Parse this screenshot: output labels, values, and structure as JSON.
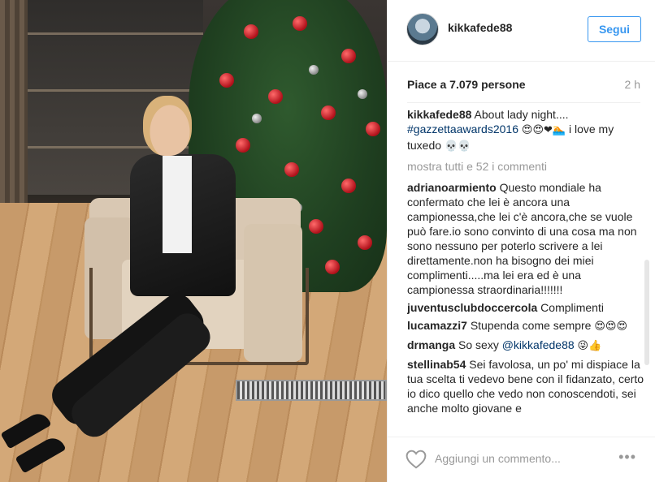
{
  "post": {
    "username": "kikkafede88",
    "follow_label": "Segui",
    "likes": "Piace a 7.079 persone",
    "time": "2 h"
  },
  "caption": {
    "user": "kikkafede88",
    "text_a": "About lady night....",
    "hashtag": "#gazzettaawards2016",
    "emoji_a": "😍😍❤🏊",
    "text_b": " i love my tuxedo ",
    "emoji_b": "💀💀"
  },
  "show_all": "mostra tutti e 52 i commenti",
  "comments": [
    {
      "user": "adrianoarmiento",
      "text": "Questo mondiale ha confermato che lei è ancora una campionessa,che lei c'è ancora,che se vuole può fare.io sono convinto di una cosa ma non sono nessuno per poterlo scrivere a lei direttamente.non ha bisogno dei miei complimenti.....ma lei era ed è una campionessa straordinaria!!!!!!!",
      "mention": "",
      "emoji": ""
    },
    {
      "user": "juventusclubdoccercola",
      "text": "Complimenti",
      "mention": "",
      "emoji": ""
    },
    {
      "user": "lucamazzi7",
      "text": "Stupenda come sempre",
      "mention": "",
      "emoji": "😍😍😍"
    },
    {
      "user": "drmanga",
      "text": "So sexy",
      "mention": "@kikkafede88",
      "emoji": "😜👍"
    },
    {
      "user": "stellinab54",
      "text": "Sei favolosa, un po' mi dispiace la tua scelta ti vedevo bene con il fidanzato, certo io dico quello che vedo non conoscendoti, sei anche molto giovane e",
      "mention": "",
      "emoji": ""
    }
  ],
  "footer": {
    "comment_placeholder": "Aggiungi un commento...",
    "more_label": "•••"
  },
  "colors": {
    "accent": "#3897f0",
    "hashtag": "#003569",
    "muted": "#999999"
  },
  "icons": [
    "heart-icon",
    "more-options-icon"
  ]
}
